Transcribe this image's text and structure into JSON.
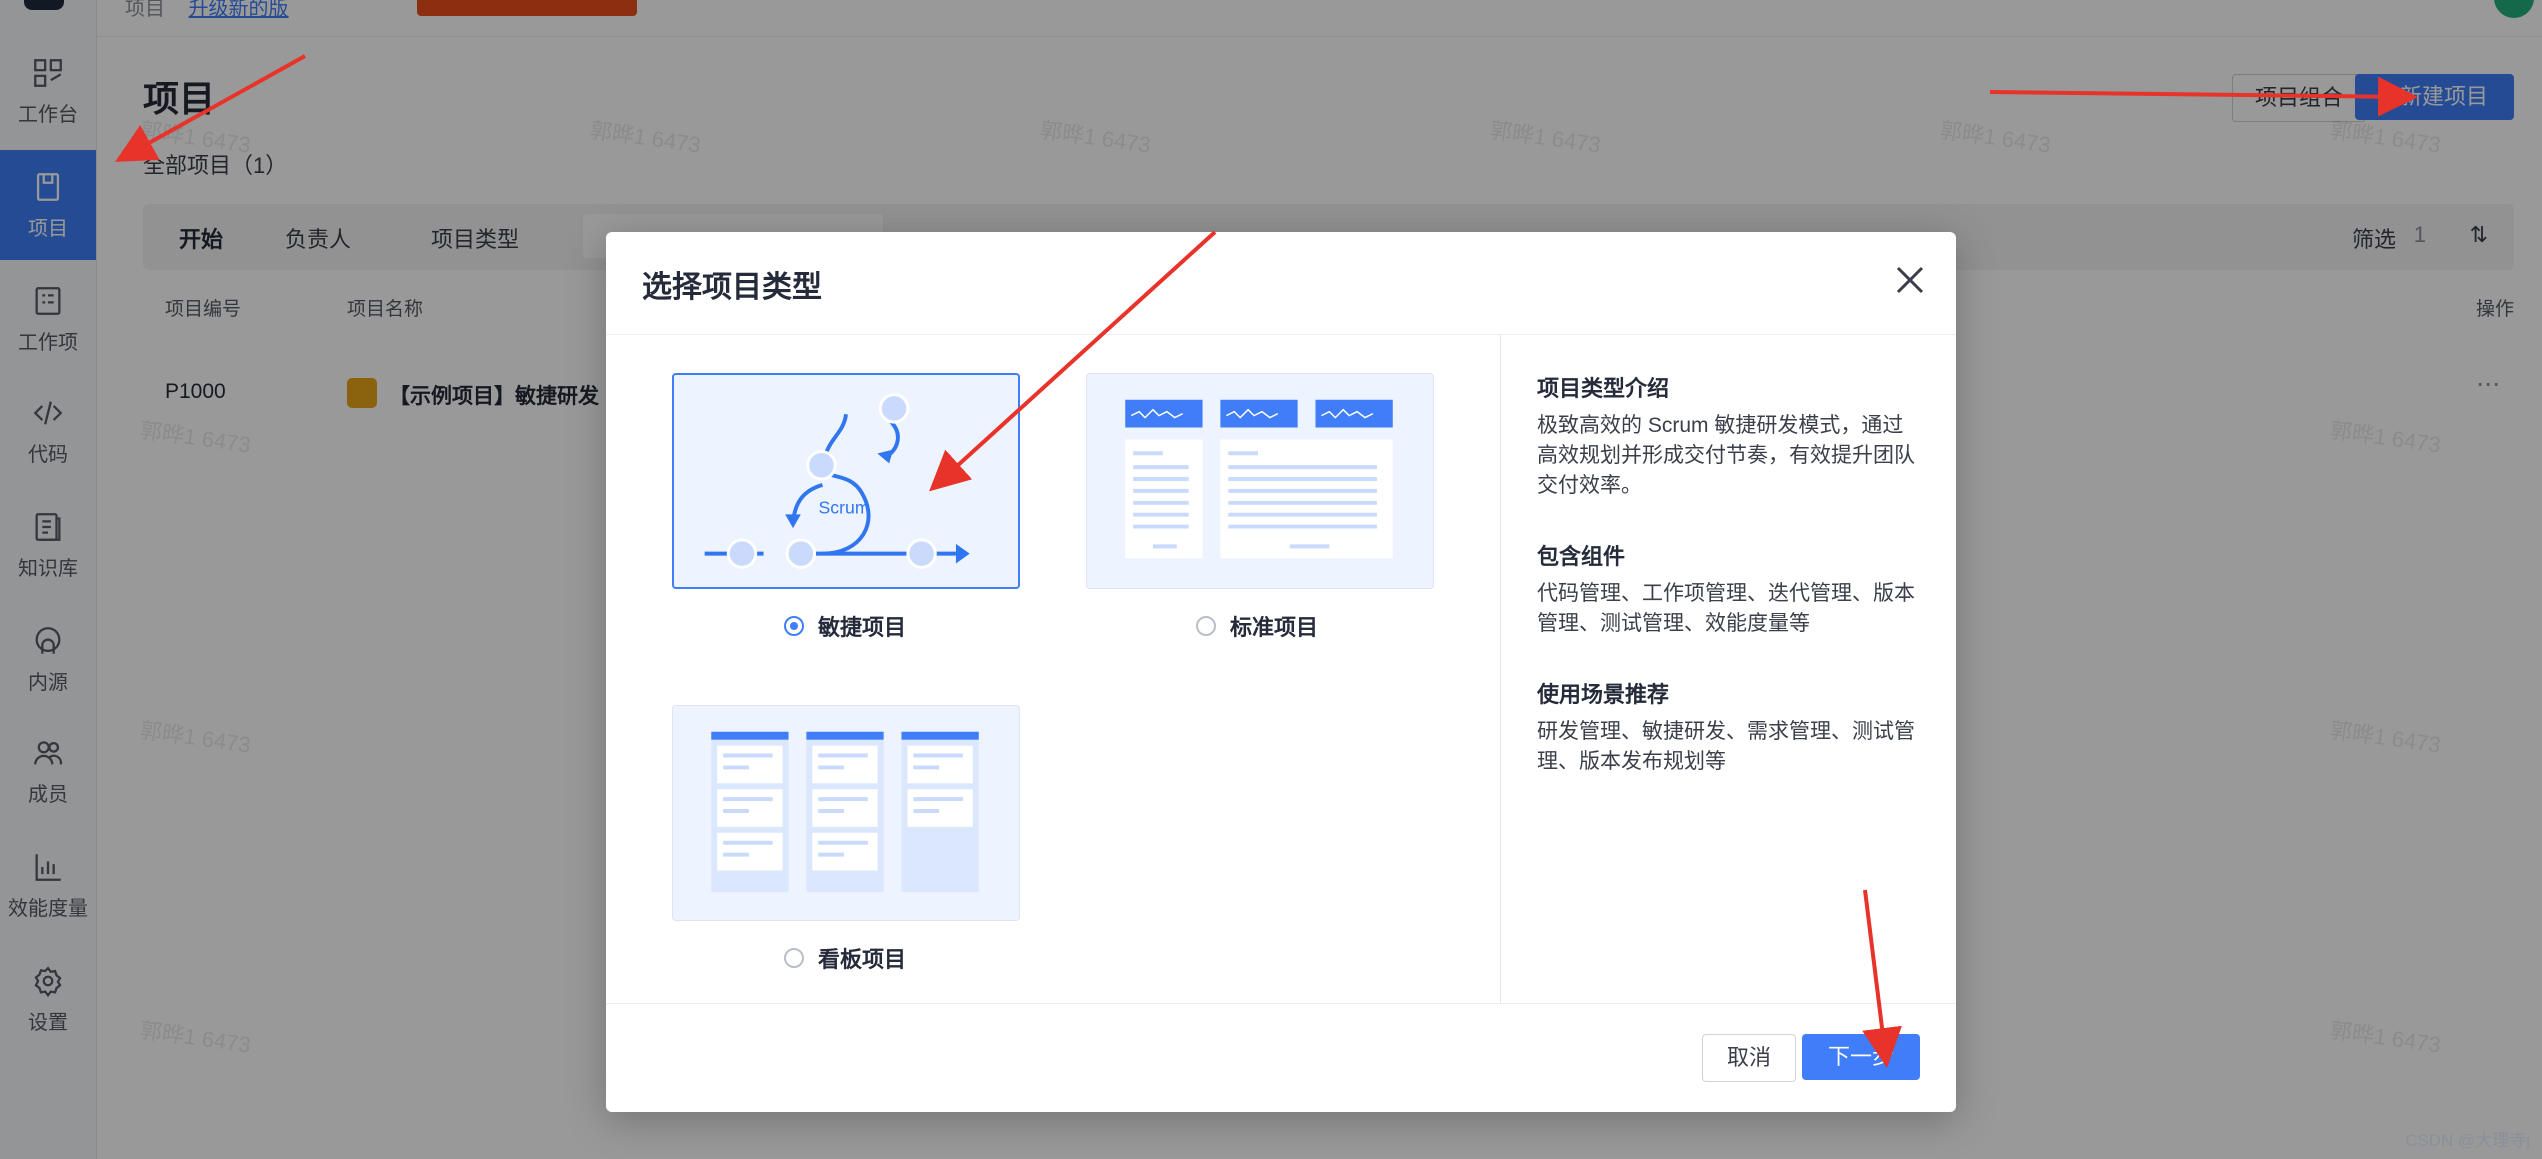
{
  "sidebar": {
    "items": [
      {
        "label": "工作台",
        "icon": "dashboard-icon"
      },
      {
        "label": "项目",
        "icon": "project-icon",
        "active": true
      },
      {
        "label": "工作项",
        "icon": "workitem-icon"
      },
      {
        "label": "代码",
        "icon": "code-icon"
      },
      {
        "label": "知识库",
        "icon": "knowledge-icon"
      },
      {
        "label": "内源",
        "icon": "innersource-icon"
      },
      {
        "label": "成员",
        "icon": "members-icon"
      },
      {
        "label": "效能度量",
        "icon": "metrics-icon"
      },
      {
        "label": "设置",
        "icon": "settings-icon"
      }
    ]
  },
  "header": {
    "breadcrumb_root": "项目",
    "breadcrumb_link": "升级新的版"
  },
  "page": {
    "title": "项目",
    "subtitle": "全部项目（1）",
    "portfolio_button": "项目组合",
    "new_project_button": "+ 新建项目",
    "filters": [
      "开始",
      "负责人",
      "项目类型"
    ],
    "filter_button": "筛选",
    "filter_count": "1",
    "columns": {
      "id": "项目编号",
      "name": "项目名称",
      "actions": "操作"
    },
    "rows": [
      {
        "id": "P1000",
        "name": "【示例项目】敏捷研发"
      }
    ]
  },
  "watermark_text": "郭晔1 6473",
  "modal": {
    "title": "选择项目类型",
    "types": [
      {
        "label": "敏捷项目",
        "selected": true,
        "art_label": "Scrum"
      },
      {
        "label": "标准项目",
        "selected": false
      },
      {
        "label": "看板项目",
        "selected": false
      }
    ],
    "info": {
      "intro_title": "项目类型介绍",
      "intro_text": "极致高效的 Scrum 敏捷研发模式，通过高效规划并形成交付节奏，有效提升团队交付效率。",
      "components_title": "包含组件",
      "components_text": "代码管理、工作项管理、迭代管理、版本管理、测试管理、效能度量等",
      "scenarios_title": "使用场景推荐",
      "scenarios_text": "研发管理、敏捷研发、需求管理、测试管理、版本发布规划等"
    },
    "cancel_button": "取消",
    "next_button": "下一步"
  },
  "footer_credit": "CSDN @大理寺j",
  "colors": {
    "accent": "#3f7ef8",
    "annotation": "#e8332a"
  }
}
